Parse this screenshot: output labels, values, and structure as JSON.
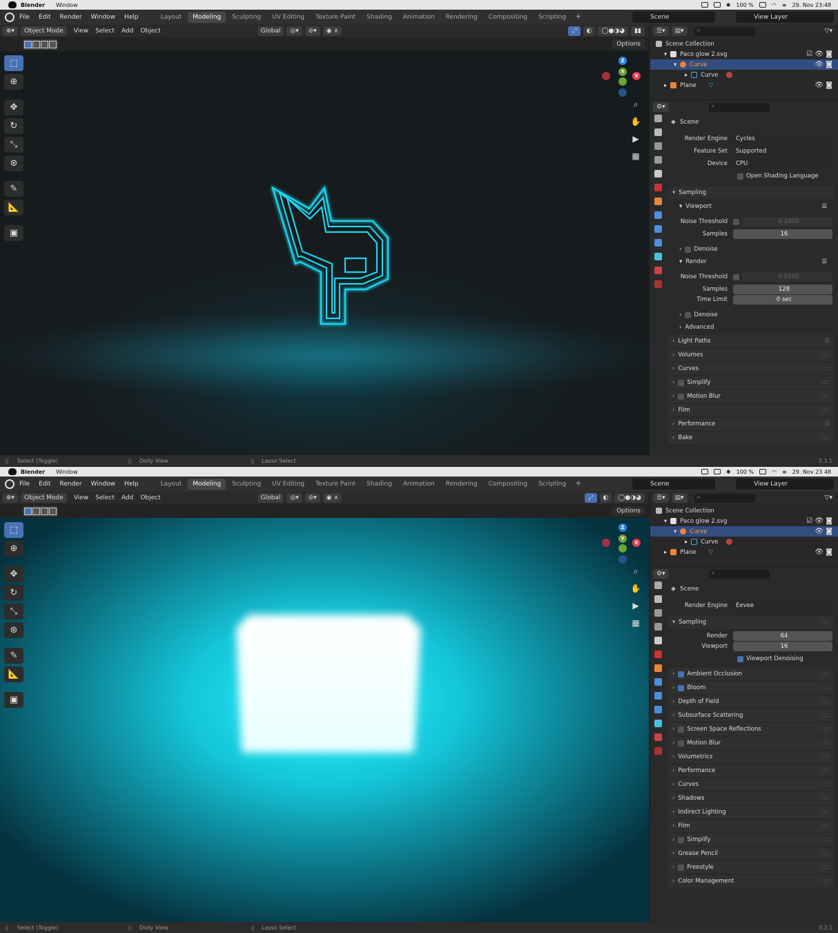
{
  "os": {
    "app_name": "Blender",
    "menu_window": "Window",
    "battery": "100 %",
    "datetime_top": "29. Nov 23:48",
    "datetime_bottom": "29. Nov 23 48"
  },
  "blender_menu": [
    "File",
    "Edit",
    "Render",
    "Window",
    "Help"
  ],
  "workspace_tabs": [
    "Layout",
    "Modeling",
    "Sculpting",
    "UV Editing",
    "Texture Paint",
    "Shading",
    "Animation",
    "Rendering",
    "Compositing",
    "Scripting"
  ],
  "active_tab": "Modeling",
  "scene_name": "Scene",
  "view_layer": "View Layer",
  "viewport_header": {
    "mode": "Object Mode",
    "menus": [
      "View",
      "Select",
      "Add",
      "Object"
    ],
    "orientation": "Global",
    "options": "Options"
  },
  "outliner": {
    "root": "Scene Collection",
    "collection": "Paco glow 2.svg",
    "obj_curve": "Curve",
    "data_curve": "Curve",
    "obj_plane": "Plane"
  },
  "status": {
    "select": "Select (Toggle)",
    "dolly": "Dolly View",
    "lasso": "Lasso Select",
    "version": "3.3.1"
  },
  "panel_top": {
    "scene_label": "Scene",
    "render_engine_label": "Render Engine",
    "render_engine": "Cycles",
    "feature_set_label": "Feature Set",
    "feature_set": "Supported",
    "device_label": "Device",
    "device": "CPU",
    "osl": "Open Shading Language",
    "sampling": "Sampling",
    "viewport": "Viewport",
    "noise_threshold_label": "Noise Threshold",
    "vp_noise_threshold": "0.1000",
    "samples_label": "Samples",
    "vp_samples": "16",
    "denoise": "Denoise",
    "render": "Render",
    "r_noise_threshold": "0.0100",
    "r_samples": "128",
    "time_limit_label": "Time Limit",
    "time_limit": "0 sec",
    "advanced": "Advanced",
    "sections": [
      "Light Paths",
      "Volumes",
      "Curves",
      "Simplify",
      "Motion Blur",
      "Film",
      "Performance",
      "Bake"
    ]
  },
  "panel_bottom": {
    "scene_label": "Scene",
    "render_engine_label": "Render Engine",
    "render_engine": "Eevee",
    "sampling": "Sampling",
    "render_label": "Render",
    "render_samples": "64",
    "viewport_label": "Viewport",
    "viewport_samples": "16",
    "viewport_denoising": "Viewport Denoising",
    "sections": [
      "Ambient Occlusion",
      "Bloom",
      "Depth of Field",
      "Subsurface Scattering",
      "Screen Space Reflections",
      "Motion Blur",
      "Volumetrics",
      "Performance",
      "Curves",
      "Shadows",
      "Indirect Lighting",
      "Film",
      "Simplify",
      "Grease Pencil",
      "Freestyle",
      "Color Management"
    ],
    "checked": [
      "Ambient Occlusion",
      "Bloom"
    ],
    "unchecked": [
      "Screen Space Reflections",
      "Motion Blur",
      "Simplify",
      "Freestyle"
    ]
  },
  "colors": {
    "accent": "#4772b3",
    "glow": "#1ed5ef",
    "curve_orange": "#e8873a"
  }
}
